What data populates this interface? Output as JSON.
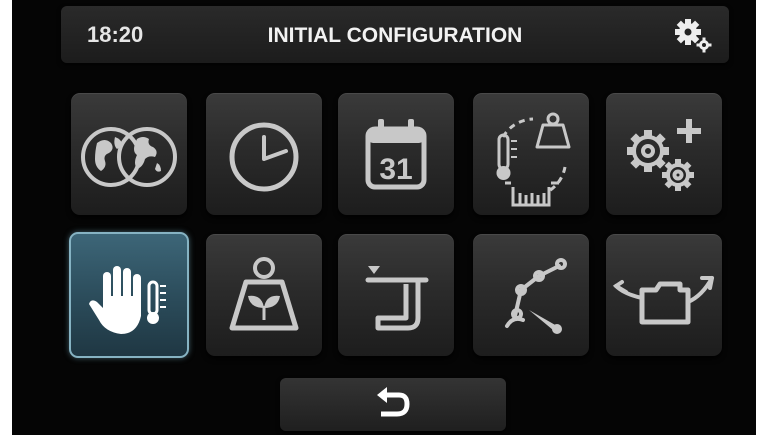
{
  "header": {
    "time": "18:20",
    "title": "INITIAL CONFIGURATION",
    "settings_icon": "gears-icon"
  },
  "tiles": [
    {
      "icon": "globe-language-icon"
    },
    {
      "icon": "clock-icon"
    },
    {
      "icon": "calendar-icon",
      "label": "31"
    },
    {
      "icon": "temperature-weight-calibration-icon"
    },
    {
      "icon": "additional-settings-icon"
    },
    {
      "icon": "hand-temperature-icon",
      "selected": true
    },
    {
      "icon": "weight-crop-icon"
    },
    {
      "icon": "tank-level-icon"
    },
    {
      "icon": "crane-arm-icon"
    },
    {
      "icon": "export-folder-icon"
    }
  ],
  "footer": {
    "back_icon": "back-arrow-icon"
  },
  "colors": {
    "background": "#050505",
    "tile": "#2b2b2b",
    "tile_selected": "#2c4d5c",
    "icon": "#bdbdbd",
    "icon_selected": "#ffffff"
  }
}
